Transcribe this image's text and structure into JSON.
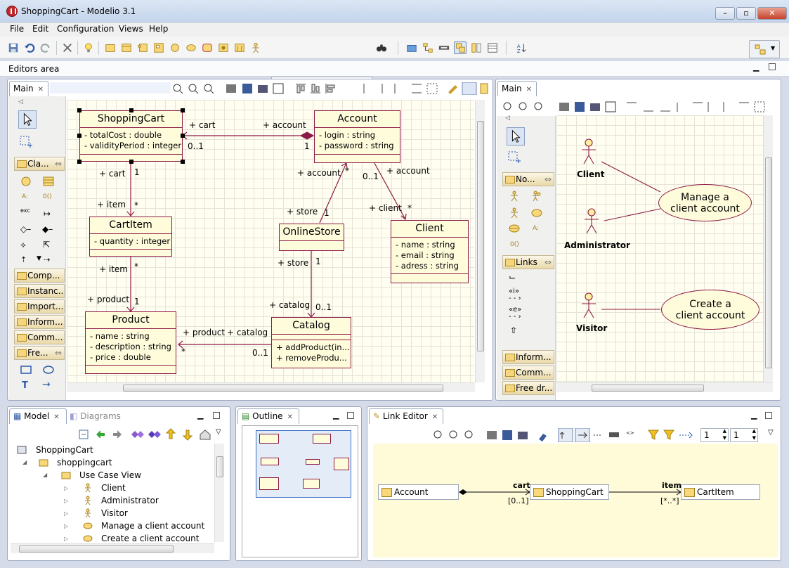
{
  "window": {
    "title": "ShoppingCart - Modelio 3.1"
  },
  "menu": [
    "File",
    "Edit",
    "Configuration",
    "Views",
    "Help"
  ],
  "editors_area": {
    "label": "Editors area"
  },
  "class_editor": {
    "tab": "Main",
    "palette": {
      "groups": [
        "Cla...",
        "Comp...",
        "Instanc...",
        "Import...",
        "Inform...",
        "Comm...",
        "Fre..."
      ]
    },
    "classes": {
      "shoppingcart": {
        "name": "ShoppingCart",
        "attrs": [
          "- totalCost : double",
          "- validityPeriod : integer"
        ]
      },
      "account": {
        "name": "Account",
        "attrs": [
          "- login : string",
          "- password : string"
        ]
      },
      "cartitem": {
        "name": "CartItem",
        "attrs": [
          "- quantity : integer"
        ]
      },
      "onlinestore": {
        "name": "OnlineStore"
      },
      "client": {
        "name": "Client",
        "attrs": [
          "- name : string",
          "- email : string",
          "- adress : string"
        ]
      },
      "product": {
        "name": "Product",
        "attrs": [
          "- name : string",
          "- description : string",
          "- price : double"
        ]
      },
      "catalog": {
        "name": "Catalog",
        "ops": [
          "+ addProduct(in...",
          "+ removeProdu..."
        ]
      }
    },
    "assoc_labels": {
      "cart_role": "+ cart",
      "account_role": "+ account",
      "mult_0_1": "0..1",
      "mult_1": "1",
      "cart2": "+ cart",
      "mult_1b": "1",
      "item": "+ item",
      "star1": "*",
      "account2": "+ account",
      "star2": "*",
      "account3": "+ account",
      "mult_0_1b": "0..1",
      "store": "+ store",
      "mult_1c": "1",
      "client_role": "+ client",
      "star3": "*",
      "item2": "+ item",
      "star4": "*",
      "product": "+ product",
      "mult_1d": "1",
      "store2": "+ store",
      "mult_1e": "1",
      "catalog_role": "+ catalog",
      "mult_0_1c": "0..1",
      "product2": "+ product",
      "catalog2": "+ catalog",
      "star5": "*",
      "mult_0_1d": "0..1"
    }
  },
  "usecase_editor": {
    "tab": "Main",
    "palette": {
      "groups": [
        "No...",
        "Links",
        "Inform...",
        "Comm...",
        "Free dr..."
      ]
    },
    "links_labels": [
      "«i»",
      "«e»"
    ],
    "actors": [
      "Client",
      "Administrator",
      "Visitor"
    ],
    "usecases": [
      "Manage a client account",
      "Create a client account"
    ]
  },
  "model_view": {
    "tabs": {
      "model": "Model",
      "diagrams": "Diagrams"
    },
    "tree": [
      "ShoppingCart",
      "shoppingcart",
      "Use Case View",
      "Client",
      "Administrator",
      "Visitor",
      "Manage a client account",
      "Create a client account"
    ]
  },
  "outline_view": {
    "tab": "Outline"
  },
  "link_editor": {
    "tab": "Link Editor",
    "spin1": "1",
    "spin2": "1",
    "nodes": [
      "Account",
      "ShoppingCart",
      "CartItem"
    ],
    "link1": {
      "role": "cart",
      "mult": "[0..1]"
    },
    "link2": {
      "role": "item",
      "mult": "[*..*]"
    }
  },
  "colors": {
    "class_border": "#8c1a46",
    "class_fill": "#fffcdc",
    "diagram_bg": "#fffef0"
  }
}
